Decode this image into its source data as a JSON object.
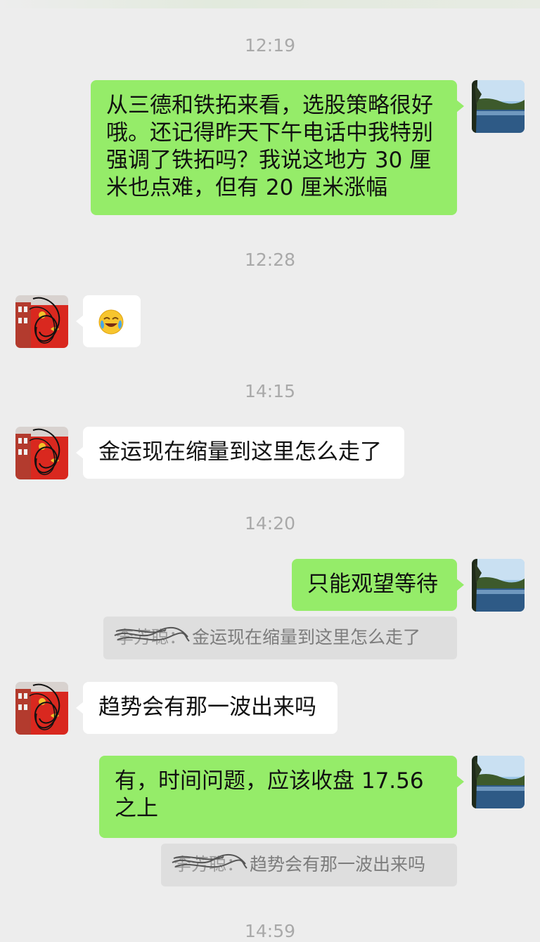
{
  "timestamps": [
    "12:19",
    "12:28",
    "14:15",
    "14:20",
    "14:59"
  ],
  "messages": {
    "m1": "从三德和铁拓来看，选股策略很好哦。还记得昨天下午电话中我特别强调了铁拓吗？我说这地方 30 厘米也点难，但有 20 厘米涨幅",
    "m2_emoji": "crying-laughing-face-emoji",
    "m3": "金运现在缩量到这里怎么走了",
    "m4": "只能观望等待",
    "q1_name": "李芳聪：",
    "q1_text": "金运现在缩量到这里怎么走了",
    "m5": "趋势会有那一波出来吗",
    "m6": "有，时间问题，应该收盘 17.56 之上",
    "q2_name": "李芳聪：",
    "q2_text": "趋势会有那一波出来吗"
  },
  "colors": {
    "background": "#ededed",
    "bubble_self": "#95ec69",
    "bubble_other": "#ffffff",
    "quote_bg": "#dedede",
    "timestamp": "#a9a9a9"
  },
  "icons": {
    "self_avatar": "lake-landscape-avatar",
    "other_avatar": "red-flag-building-avatar-scribbled"
  }
}
